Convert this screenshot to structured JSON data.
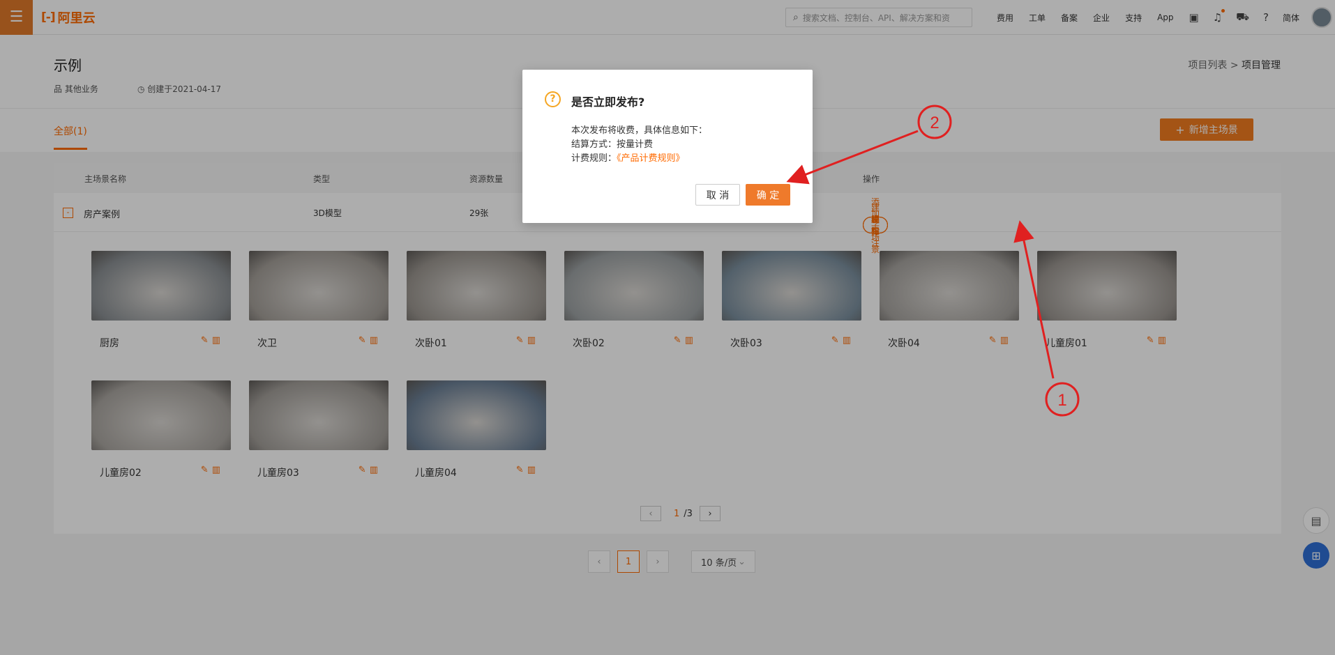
{
  "topbar": {
    "logo_text": "阿里云",
    "logo_mark": "[-]",
    "search_placeholder": "搜索文档、控制台、API、解决方案和资",
    "nav": [
      "费用",
      "工单",
      "备案",
      "企业",
      "支持",
      "App"
    ],
    "lang": "简体"
  },
  "page": {
    "title": "示例",
    "category": "其他业务",
    "created": "创建于2021-04-17",
    "breadcrumb_parent": "项目列表",
    "breadcrumb_sep": ">",
    "breadcrumb_current": "项目管理",
    "tab_all": "全部(1)",
    "add_button": "新增主场景"
  },
  "table": {
    "headers": [
      "主场景名称",
      "类型",
      "资源数量",
      "操作"
    ],
    "row": {
      "collapse_symbol": "-",
      "name": "房产案例",
      "type": "3D模型",
      "count": "29张"
    },
    "ops": [
      "添加子场景",
      "建模标注",
      "发 布",
      "编 辑",
      "删 除"
    ]
  },
  "scenes": [
    {
      "name": "厨房",
      "color": "#8a8f93"
    },
    {
      "name": "次卫",
      "color": "#a39e98"
    },
    {
      "name": "次卧01",
      "color": "#9a958f"
    },
    {
      "name": "次卧02",
      "color": "#9ca1a3"
    },
    {
      "name": "次卧03",
      "color": "#7b8f9e"
    },
    {
      "name": "次卧04",
      "color": "#a6a39f"
    },
    {
      "name": "儿童房01",
      "color": "#9a9590"
    },
    {
      "name": "儿童房02",
      "color": "#a9a5a0"
    },
    {
      "name": "儿童房03",
      "color": "#a19d98"
    },
    {
      "name": "儿童房04",
      "color": "#6b7f95"
    }
  ],
  "inner_pager": {
    "current": "1",
    "total": "/3"
  },
  "pager": {
    "current": "1",
    "size": "10 条/页"
  },
  "modal": {
    "title": "是否立即发布?",
    "line1": "本次发布将收费，具体信息如下：",
    "line2_label": "结算方式：",
    "line2_value": "按量计费",
    "line3_label": "计费规则：",
    "line3_link": "《产品计费规则》",
    "cancel": "取 消",
    "ok": "确 定"
  },
  "annotations": {
    "one": "1",
    "two": "2",
    "color": "#e02020"
  }
}
